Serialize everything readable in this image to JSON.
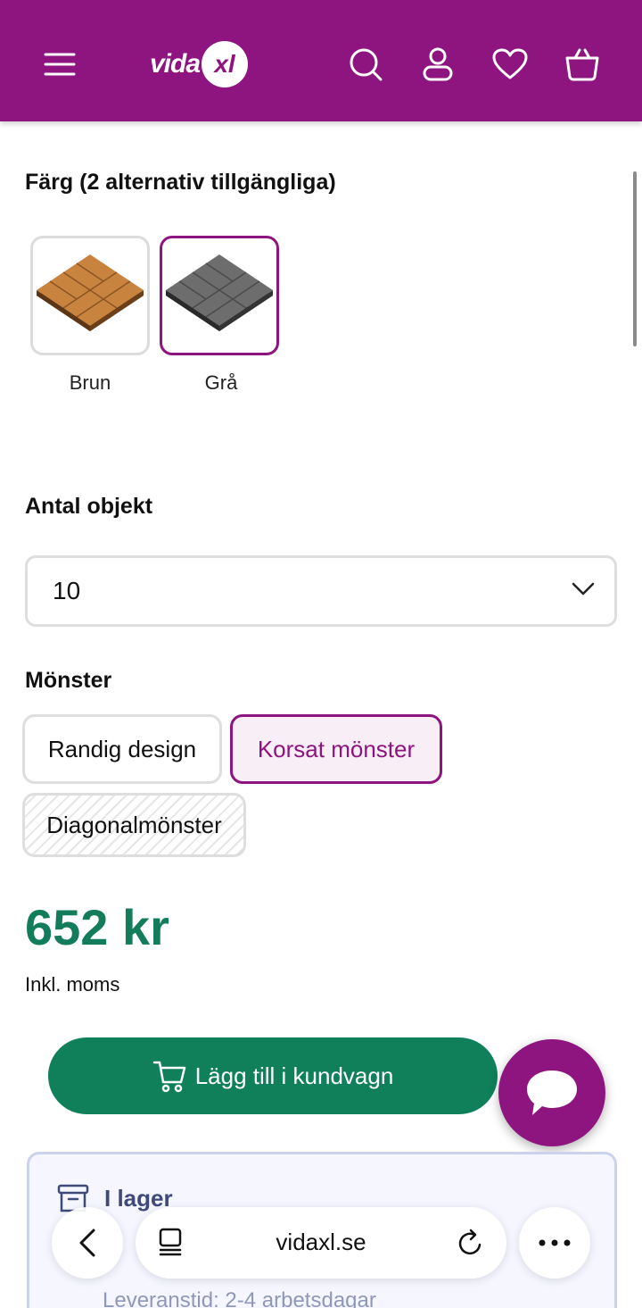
{
  "header": {
    "logo_text": "vida",
    "logo_mark": "xl",
    "icons": [
      "menu-icon",
      "search-icon",
      "account-icon",
      "heart-icon",
      "basket-icon"
    ],
    "brand_color": "#8e147f"
  },
  "color": {
    "title": "Färg (2 alternativ tillgängliga)",
    "options": [
      {
        "label": "Brun",
        "selected": false
      },
      {
        "label": "Grå",
        "selected": true
      }
    ]
  },
  "quantity": {
    "title": "Antal objekt",
    "value": "10"
  },
  "pattern": {
    "title": "Mönster",
    "options": [
      {
        "label": "Randig design",
        "state": "available"
      },
      {
        "label": "Korsat mönster",
        "state": "selected"
      },
      {
        "label": "Diagonalmönster",
        "state": "unavailable"
      }
    ]
  },
  "price": {
    "amount": "652 kr",
    "vat_note": "Inkl. moms",
    "color": "#137c5a"
  },
  "cart": {
    "label": "Lägg till i kundvagn"
  },
  "stock": {
    "status": "I lager",
    "delivery": "Leveranstid: 2-4 arbetsdagar"
  },
  "browser": {
    "url": "vidaxl.se"
  }
}
